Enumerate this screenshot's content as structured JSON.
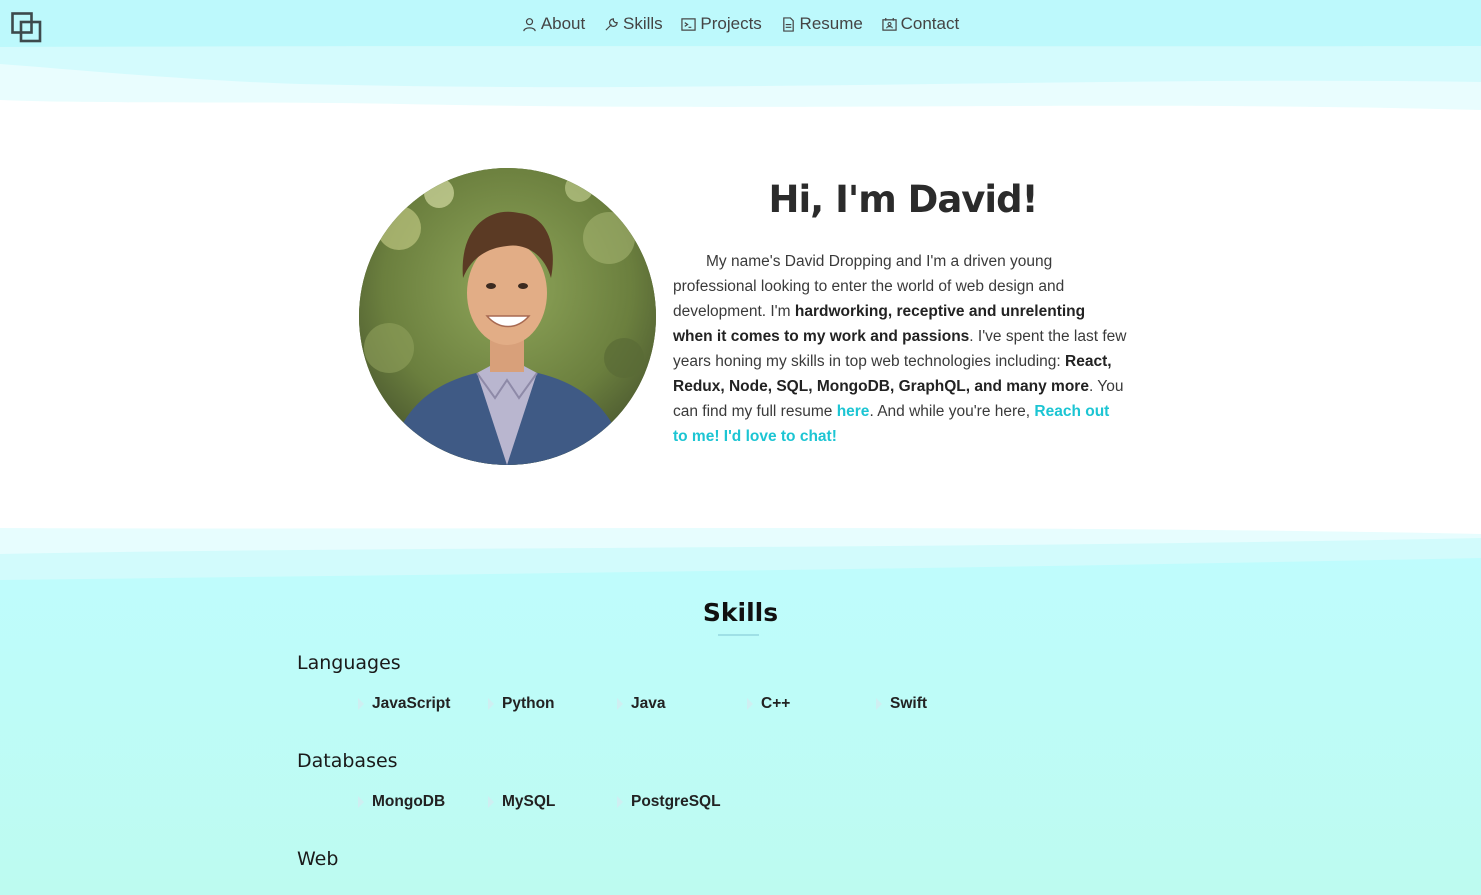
{
  "nav": {
    "items": [
      {
        "label": "About",
        "icon": "user-icon"
      },
      {
        "label": "Skills",
        "icon": "wrench-icon"
      },
      {
        "label": "Projects",
        "icon": "terminal-icon"
      },
      {
        "label": "Resume",
        "icon": "document-icon"
      },
      {
        "label": "Contact",
        "icon": "contact-card-icon"
      }
    ]
  },
  "hero": {
    "title": "Hi, I'm David!",
    "p1": "My name's David Dropping and I'm a driven young professional looking to enter the world of web design and development. I'm ",
    "b1": "hardworking, receptive and unrelenting when it comes to my work and passions",
    "p2": ". I've spent the last few years honing my skills in top web technologies including: ",
    "b2": "React, Redux, Node, SQL, MongoDB, GraphQL, and many more",
    "p3": ". You can find my full resume ",
    "link_here": "here",
    "p4": ". And while you're here, ",
    "link_chat": "Reach out to me! I'd love to chat!"
  },
  "skills": {
    "title": "Skills",
    "groups": [
      {
        "name": "Languages",
        "items": [
          "JavaScript",
          "Python",
          "Java",
          "C++",
          "Swift"
        ]
      },
      {
        "name": "Databases",
        "items": [
          "MongoDB",
          "MySQL",
          "PostgreSQL"
        ]
      },
      {
        "name": "Web",
        "items": []
      }
    ]
  },
  "colors": {
    "accent": "#1cc5d3",
    "nav_bg": "#bdf9fc",
    "skills_bg": "#c0fdfb"
  }
}
